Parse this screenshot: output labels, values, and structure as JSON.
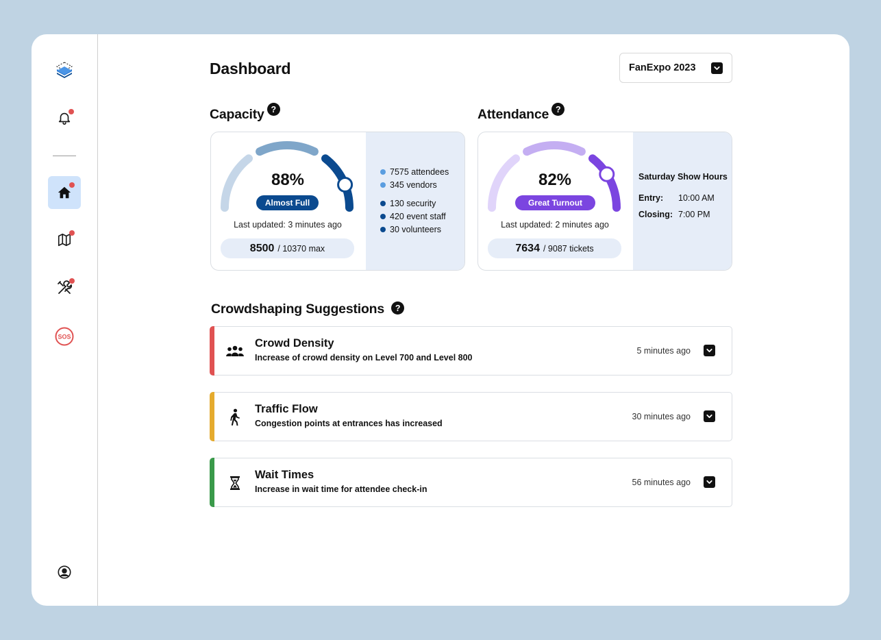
{
  "sidebar": {
    "items": [
      {
        "name": "app-logo",
        "icon": "stacked-layers-logo-icon"
      },
      {
        "name": "notifications",
        "icon": "bell-icon",
        "has_alert": true
      },
      {
        "name": "home",
        "icon": "home-icon",
        "active": true,
        "has_alert": true
      },
      {
        "name": "map",
        "icon": "map-icon",
        "has_alert": true
      },
      {
        "name": "tools",
        "icon": "tools-icon",
        "has_alert": true
      },
      {
        "name": "sos",
        "icon": "sos-icon",
        "label": "SOS"
      },
      {
        "name": "profile",
        "icon": "user-circle-icon"
      }
    ],
    "alert_color": "#e05252",
    "active_bg": "#cfe3fb"
  },
  "header": {
    "title": "Dashboard",
    "event_select": {
      "value": "FanExpo 2023",
      "icon": "chevron-down-icon"
    }
  },
  "capacity": {
    "heading": "Capacity",
    "help": "?",
    "percent_label": "88%",
    "percent_value": 0.88,
    "status": "Almost Full",
    "status_color": "#0b4a8f",
    "last_updated": "Last updated: 3 minutes ago",
    "count": "8500",
    "count_suffix": "/ 10370 max",
    "legend": [
      {
        "text": "7575 attendees",
        "color": "#5a9de0"
      },
      {
        "text": "345 vendors",
        "color": "#5a9de0"
      },
      {
        "text": "130 security",
        "color": "#0b4a8f"
      },
      {
        "text": "420 event staff",
        "color": "#0b4a8f"
      },
      {
        "text": "30 volunteers",
        "color": "#0b4a8f"
      }
    ],
    "gauge_colors": [
      "#c5d6e8",
      "#7fa6c9",
      "#0b4a8f"
    ]
  },
  "attendance": {
    "heading": "Attendance",
    "help": "?",
    "percent_label": "82%",
    "percent_value": 0.82,
    "status": "Great Turnout",
    "status_color": "#7b45e0",
    "last_updated": "Last updated: 2 minutes ago",
    "count": "7634",
    "count_suffix": "/ 9087 tickets",
    "hours": {
      "title": "Saturday Show Hours",
      "entry_label": "Entry:",
      "entry_value": "10:00 AM",
      "closing_label": "Closing:",
      "closing_value": "7:00 PM"
    },
    "gauge_colors": [
      "#e0d4fa",
      "#c4aef2",
      "#7b45e0"
    ]
  },
  "suggestions": {
    "heading": "Crowdshaping Suggestions",
    "help": "?",
    "items": [
      {
        "title": "Crowd Density",
        "desc": "Increase of crowd density on Level 700 and Level 800",
        "time": "5 minutes ago",
        "icon": "people-group-icon",
        "color": "#e05252"
      },
      {
        "title": "Traffic Flow",
        "desc": "Congestion points at entrances has increased",
        "time": "30 minutes ago",
        "icon": "walking-person-icon",
        "color": "#e5ab2e"
      },
      {
        "title": "Wait Times",
        "desc": "Increase in wait time for attendee check-in",
        "time": "56 minutes ago",
        "icon": "hourglass-icon",
        "color": "#3a9a4a"
      }
    ]
  }
}
